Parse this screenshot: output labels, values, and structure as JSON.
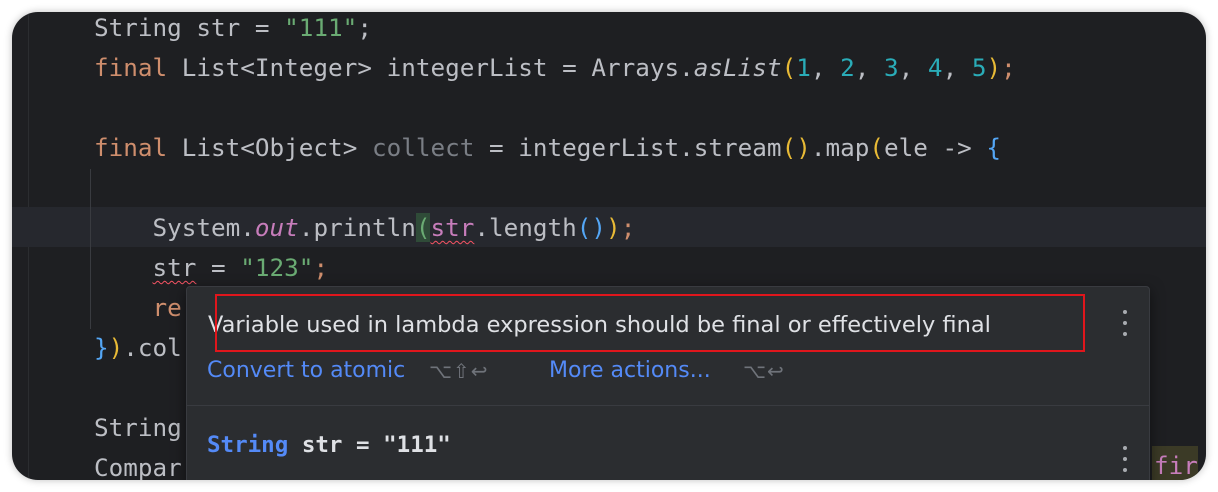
{
  "editor": {
    "lines": [
      {
        "tokens": [
          [
            "String str = ",
            ""
          ],
          [
            "\"111\"",
            "str"
          ],
          [
            ";",
            ""
          ]
        ]
      },
      {
        "tokens": [
          [
            "final",
            "kw"
          ],
          [
            " List<",
            ""
          ],
          [
            "Integer",
            ""
          ],
          [
            "> integerList = Arrays.",
            ""
          ],
          [
            "asList",
            "italic"
          ],
          [
            "(",
            "paren-y"
          ],
          [
            "1",
            "num"
          ],
          [
            ", ",
            ""
          ],
          [
            "2",
            "num"
          ],
          [
            ", ",
            ""
          ],
          [
            "3",
            "num"
          ],
          [
            ", ",
            ""
          ],
          [
            "4",
            "num"
          ],
          [
            ", ",
            ""
          ],
          [
            "5",
            "num"
          ],
          [
            ")",
            "paren-y"
          ],
          [
            ";",
            "kw"
          ]
        ]
      },
      {
        "tokens": []
      },
      {
        "tokens": [
          [
            "final",
            "kw"
          ],
          [
            " List<",
            ""
          ],
          [
            "Object",
            ""
          ],
          [
            "> ",
            ""
          ],
          [
            "collect",
            "gray"
          ],
          [
            " = integerList.stream",
            ""
          ],
          [
            "()",
            "paren-y"
          ],
          [
            ".map",
            ""
          ],
          [
            "(",
            "paren-y"
          ],
          [
            "ele -> ",
            ""
          ],
          [
            "{",
            "paren-b"
          ]
        ]
      },
      {
        "tokens": []
      },
      {
        "tokens": [
          [
            "    System.",
            ""
          ],
          [
            "out",
            "field"
          ],
          [
            ".println",
            ""
          ],
          [
            "(",
            "paren-g match-bg"
          ],
          [
            "str",
            "err paren-p"
          ],
          [
            ".length",
            ""
          ],
          [
            "()",
            "paren-b"
          ],
          [
            ")",
            "paren-y"
          ],
          [
            ";",
            "kw"
          ]
        ]
      },
      {
        "tokens": [
          [
            "    ",
            ""
          ],
          [
            "str",
            "err"
          ],
          [
            " = ",
            ""
          ],
          [
            "\"123\"",
            "str"
          ],
          [
            ";",
            "kw"
          ]
        ]
      },
      {
        "tokens": [
          [
            "    re",
            "kw"
          ]
        ]
      },
      {
        "tokens": [
          [
            "}",
            "paren-b"
          ],
          [
            ")",
            "paren-y"
          ],
          [
            ".col",
            ""
          ]
        ]
      },
      {
        "tokens": []
      },
      {
        "tokens": [
          [
            "String",
            ""
          ]
        ]
      },
      {
        "tokens": [
          [
            "Compar",
            ""
          ]
        ]
      }
    ],
    "right_peek": "fir"
  },
  "popup": {
    "message": "Variable used in lambda expression should be final or effectively final",
    "action_primary": "Convert to atomic",
    "action_primary_shortcut": "⌥⇧↩",
    "action_more": "More actions...",
    "action_more_shortcut": "⌥↩",
    "declaration_type": "String",
    "declaration_rest": " str = \"111\""
  }
}
